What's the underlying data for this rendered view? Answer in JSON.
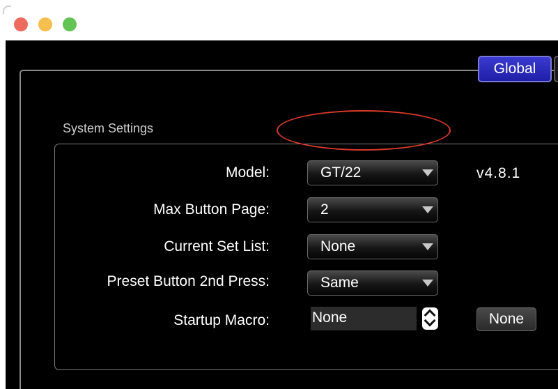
{
  "window": {
    "controls": [
      "close",
      "minimize",
      "zoom"
    ]
  },
  "tabs": {
    "active": "Global"
  },
  "section": {
    "title": "System Settings"
  },
  "settings": {
    "model": {
      "label": "Model:",
      "value": "GT/22",
      "version": "v4.8.1"
    },
    "max_button_page": {
      "label": "Max Button Page:",
      "value": "2"
    },
    "current_set_list": {
      "label": "Current Set List:",
      "value": "None"
    },
    "preset_button_2nd_press": {
      "label": "Preset Button 2nd Press:",
      "value": "Same"
    },
    "startup_macro": {
      "label": "Startup Macro:",
      "value": "None",
      "button_label": "None"
    }
  },
  "icons": {
    "dropdown": "chevron-down-icon",
    "stepper": "up-down-stepper-icon"
  },
  "colors": {
    "tab_active": "#2a2abf",
    "highlight": "#d93a2b",
    "background": "#000000"
  }
}
